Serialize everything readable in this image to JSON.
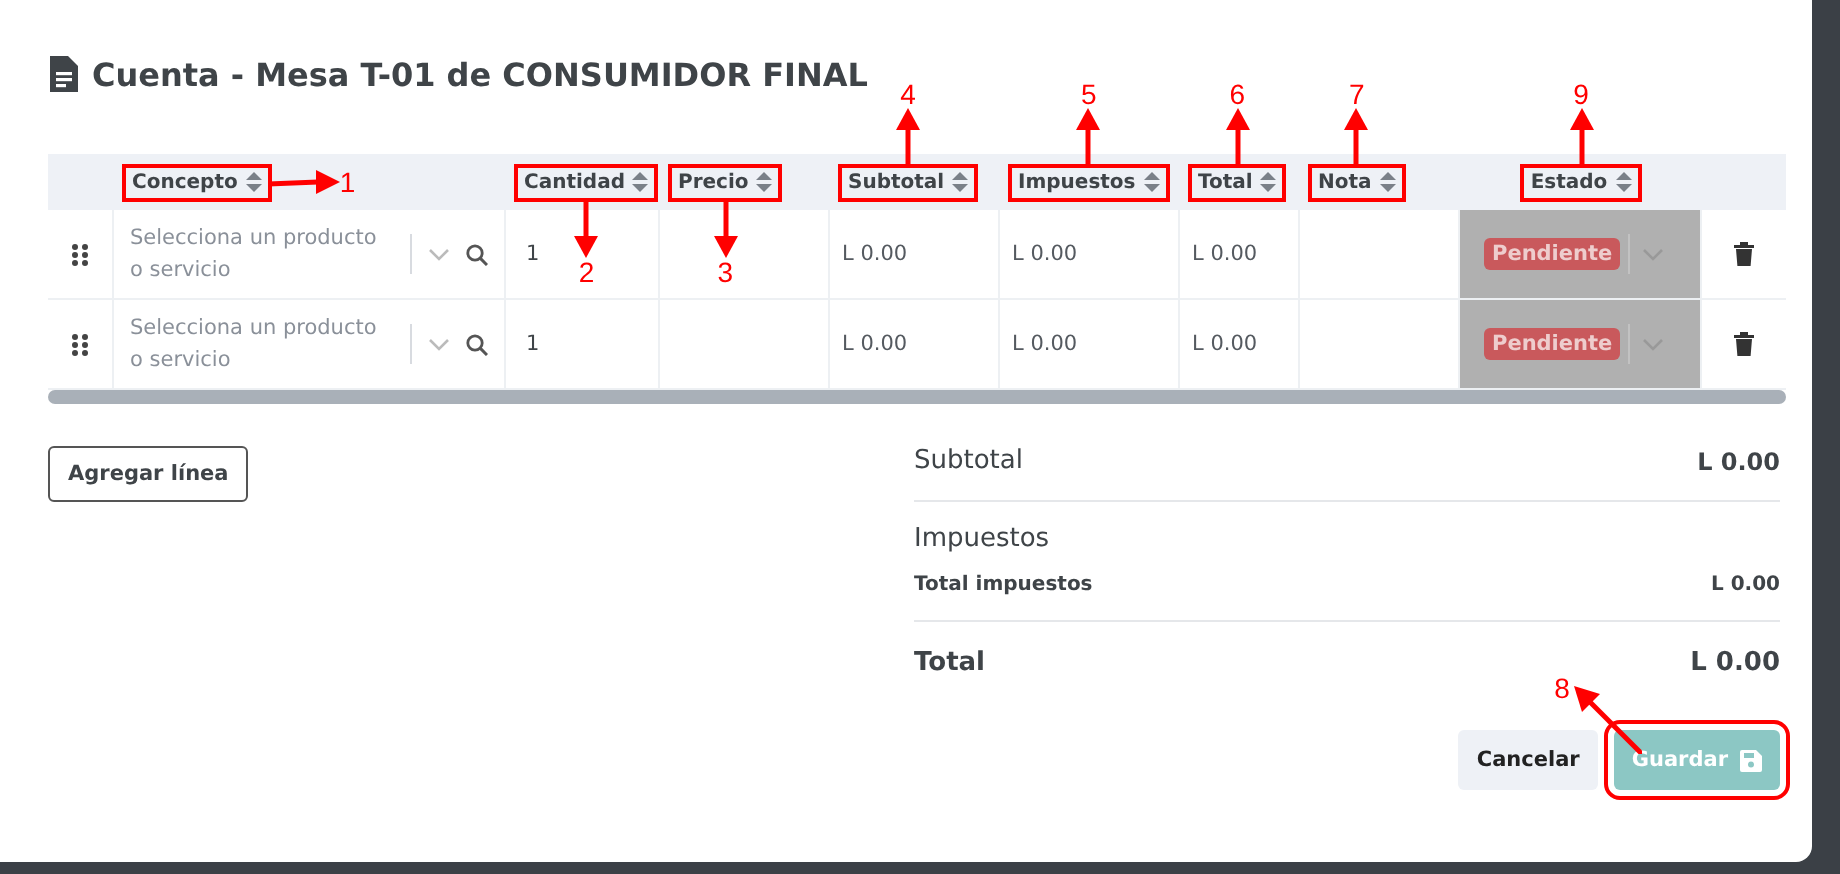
{
  "dialog": {
    "title": "Cuenta - Mesa T-01 de CONSUMIDOR FINAL"
  },
  "table": {
    "columns": [
      {
        "label": "Concepto",
        "annotation": {
          "number": "1",
          "kind": "right"
        }
      },
      {
        "label": "Cantidad",
        "annotation": {
          "number": "2",
          "kind": "down"
        }
      },
      {
        "label": "Precio",
        "annotation": {
          "number": "3",
          "kind": "down"
        }
      },
      {
        "label": "Subtotal",
        "annotation": {
          "number": "4",
          "kind": "up"
        }
      },
      {
        "label": "Impuestos",
        "annotation": {
          "number": "5",
          "kind": "up"
        }
      },
      {
        "label": "Total",
        "annotation": {
          "number": "6",
          "kind": "up"
        }
      },
      {
        "label": "Nota",
        "annotation": {
          "number": "7",
          "kind": "up"
        }
      },
      {
        "label": "Estado",
        "annotation": {
          "number": "9",
          "kind": "up"
        }
      }
    ],
    "rows": [
      {
        "concept_placeholder": "Selecciona un producto o servicio",
        "quantity": "1",
        "subtotal": "L 0.00",
        "taxes": "L 0.00",
        "total": "L 0.00",
        "status": "Pendiente",
        "status_disabled": true
      },
      {
        "concept_placeholder": "Selecciona un producto o servicio",
        "quantity": "1",
        "subtotal": "L 0.00",
        "taxes": "L 0.00",
        "total": "L 0.00",
        "status": "Pendiente",
        "status_disabled": true
      }
    ]
  },
  "add_line_button": "Agregar línea",
  "summary": {
    "subtotal_label": "Subtotal",
    "subtotal": "L 0.00",
    "taxes_heading": "Impuestos",
    "total_taxes_label": "Total impuestos",
    "total_taxes": "L 0.00",
    "total_label": "Total",
    "total": "L 0.00"
  },
  "buttons": [
    {
      "label": "Cancelar",
      "kind": "cancel"
    },
    {
      "label": "Guardar",
      "kind": "save",
      "disabled": true,
      "annotation": {
        "number": "8",
        "kind": "up-left"
      }
    }
  ]
}
